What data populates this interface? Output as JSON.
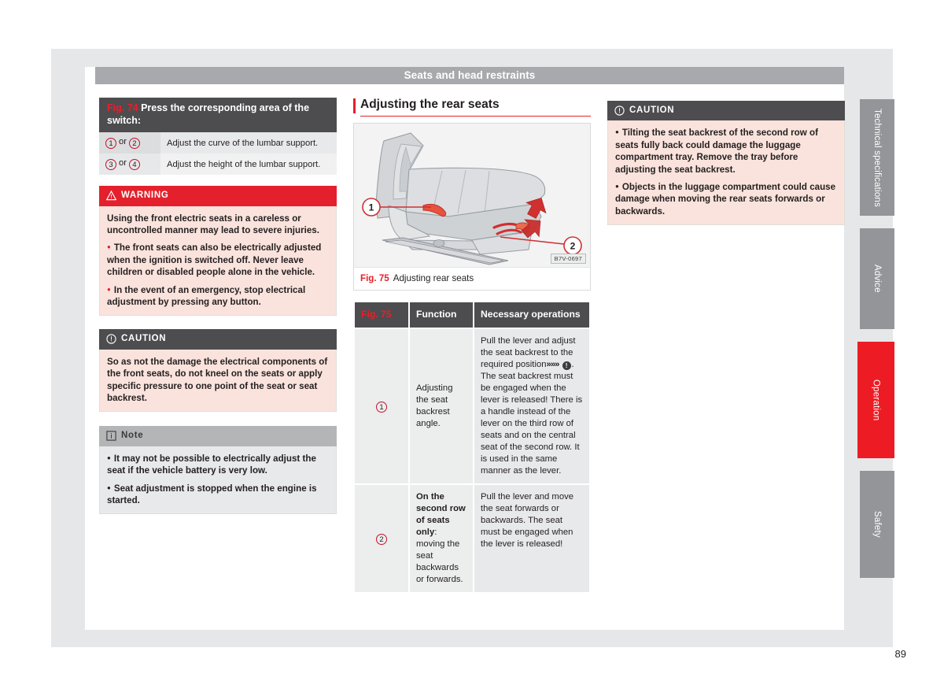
{
  "header": {
    "title": "Seats and head restraints"
  },
  "page_number": "89",
  "column_left": {
    "fig74": {
      "fignum": "Fig. 74",
      "title": "Press the corresponding area of the switch:",
      "rows": [
        {
          "marks": [
            "1",
            "2"
          ],
          "or": "or",
          "text": "Adjust the curve of the lumbar support."
        },
        {
          "marks": [
            "3",
            "4"
          ],
          "or": "or",
          "text": "Adjust the height of the lumbar support."
        }
      ]
    },
    "warning": {
      "icon": "warning-triangle-icon",
      "title": "WARNING",
      "paragraphs": [
        {
          "bullet": false,
          "text": "Using the front electric seats in a careless or uncontrolled manner may lead to severe injuries."
        },
        {
          "bullet": true,
          "text": "The front seats can also be electrically adjusted when the ignition is switched off. Never leave children or disabled people alone in the vehicle."
        },
        {
          "bullet": true,
          "text": "In the event of an emergency, stop electrical adjustment by pressing any button."
        }
      ]
    },
    "caution": {
      "icon": "caution-circle-icon",
      "title": "CAUTION",
      "paragraphs": [
        {
          "bullet": false,
          "text": "So as not the damage the electrical components of the front seats, do not kneel on the seats or apply specific pressure to one point of the seat or seat backrest."
        }
      ]
    },
    "note": {
      "icon": "info-icon",
      "title": "Note",
      "paragraphs": [
        {
          "bullet": true,
          "text": "It may not be possible to electrically adjust the seat if the vehicle battery is very low."
        },
        {
          "bullet": true,
          "text": "Seat adjustment is stopped when the engine is started."
        }
      ]
    }
  },
  "column_middle": {
    "section_title": "Adjusting the rear seats",
    "figure": {
      "code": "B7V-0697",
      "caption_num": "Fig. 75",
      "caption_text": "Adjusting rear seats",
      "callouts": [
        "1",
        "2"
      ]
    },
    "table": {
      "headers": [
        "Fig. 75",
        "Function",
        "Necessary operations"
      ],
      "rows": [
        {
          "mark": "1",
          "function": "Adjusting the seat backrest angle.",
          "function_bold": "",
          "operations_pre": "Pull the lever and adjust the seat backrest to the required position",
          "operations_ref": "»",
          "operations_post": ". The seat backrest must be engaged when the lever is released! There is a handle instead of the lever on the third row of seats and on the central seat of the second row. It is used in the same manner as the lever."
        },
        {
          "mark": "2",
          "function_bold": "On the second row of seats only",
          "function": ": moving the seat backwards or forwards.",
          "operations_pre": "Pull the lever and move the seat forwards or backwards. The seat must be engaged when the lever is released!",
          "operations_ref": "",
          "operations_post": ""
        }
      ]
    }
  },
  "column_right": {
    "caution": {
      "icon": "caution-circle-icon",
      "title": "CAUTION",
      "paragraphs": [
        {
          "bullet": true,
          "text": "Tilting the seat backrest of the second row of seats fully back could damage the luggage compartment tray. Remove the tray before adjusting the seat backrest."
        },
        {
          "bullet": true,
          "text": "Objects in the luggage compartment could cause damage when moving the rear seats forwards or backwards."
        }
      ]
    }
  },
  "side_tabs": [
    {
      "label": "Technical specifications",
      "active": false
    },
    {
      "label": "Advice",
      "active": false
    },
    {
      "label": "Operation",
      "active": true
    },
    {
      "label": "Safety",
      "active": false
    }
  ],
  "colors": {
    "brand_red": "#e4202c",
    "tab_active_red": "#ed1c24",
    "header_gray": "#a7a9ac",
    "dark_header": "#4d4d4f",
    "pink_body": "#fae3dc",
    "gray_body": "#e8e9ea",
    "page_bg": "#e6e7e9"
  }
}
